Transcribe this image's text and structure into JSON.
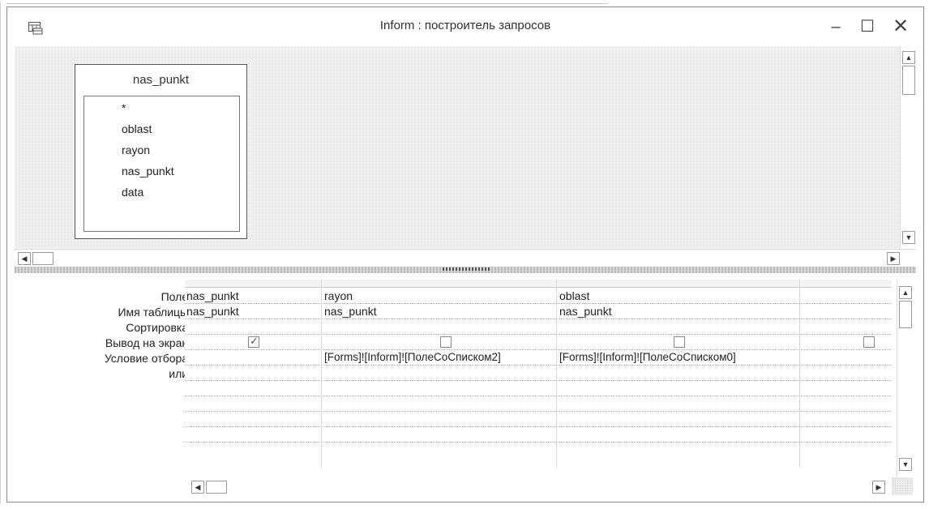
{
  "window": {
    "title": "Inform : построитель запросов",
    "controls": {
      "minimize": "–",
      "maximize": "☐",
      "close": "✕"
    }
  },
  "table": {
    "name": "nas_punkt",
    "fields": [
      "*",
      "oblast",
      "rayon",
      "nas_punkt",
      "data"
    ]
  },
  "grid": {
    "row_labels": [
      "Поле:",
      "Имя таблицы:",
      "Сортировка:",
      "Вывод на экран:",
      "Условие отбора:",
      "или:"
    ],
    "columns": [
      {
        "field": "nas_punkt",
        "table": "nas_punkt",
        "sort": "",
        "show": true,
        "criteria": ""
      },
      {
        "field": "rayon",
        "table": "nas_punkt",
        "sort": "",
        "show": false,
        "criteria": "[Forms]![Inform]![ПолеСоСписком2]"
      },
      {
        "field": "oblast",
        "table": "nas_punkt",
        "sort": "",
        "show": false,
        "criteria": "[Forms]![Inform]![ПолеСоСписком0]"
      },
      {
        "field": "",
        "table": "",
        "sort": "",
        "show": false,
        "criteria": ""
      }
    ]
  },
  "icons": {
    "app": "query-design-icon",
    "scroll_up": "▲",
    "scroll_down": "▼",
    "scroll_left": "◀",
    "scroll_right": "▶",
    "check": "✓"
  }
}
